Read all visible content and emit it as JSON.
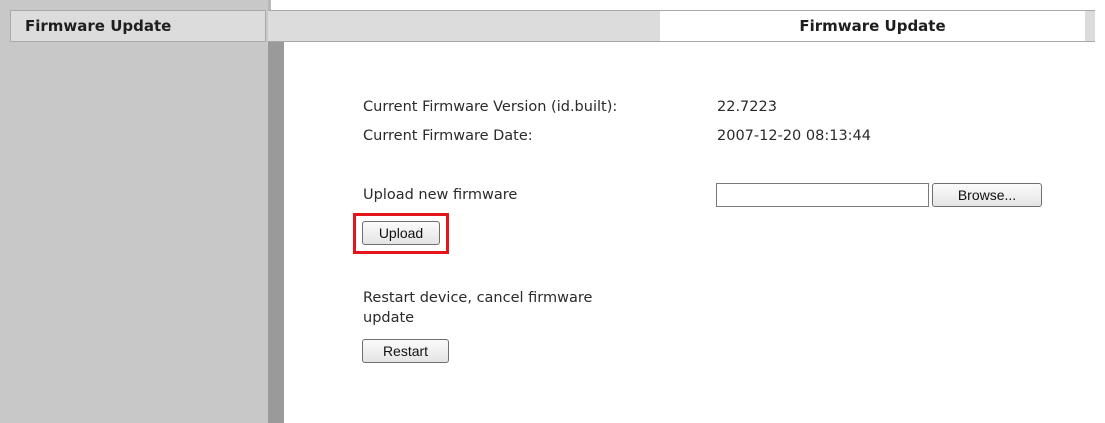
{
  "sidebar": {
    "title": "Firmware Update"
  },
  "header": {
    "title": "Firmware Update"
  },
  "info": {
    "version_label": "Current Firmware Version (id.built):",
    "version_value": "22.7223",
    "date_label": "Current Firmware Date:",
    "date_value": "2007-12-20  08:13:44"
  },
  "upload": {
    "label": "Upload new firmware",
    "file_value": "",
    "browse_label": "Browse...",
    "upload_label": "Upload",
    "highlight_color": "#e3141b"
  },
  "restart": {
    "label_line1": "Restart device, cancel firmware",
    "label_line2": "update",
    "button_label": "Restart"
  }
}
